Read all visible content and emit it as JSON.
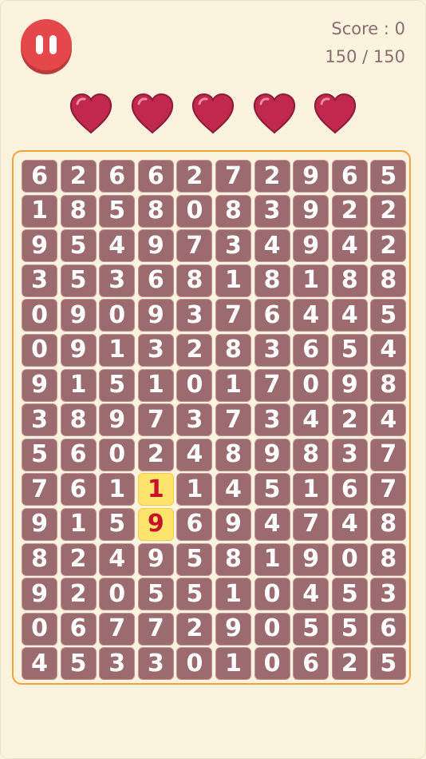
{
  "header": {
    "pause_icon": "pause-icon",
    "score_label": "Score : 0",
    "counter_label": "150 / 150"
  },
  "lives": {
    "count": 5,
    "icon": "heart-icon",
    "color": "#c0284d"
  },
  "colors": {
    "background": "#fbf3dd",
    "pause_button": "#e4484a",
    "cell": "#9c6b6f",
    "cell_highlight": "#fde46a",
    "highlight_text": "#c8102e",
    "board_border": "#f2a43a"
  },
  "board": {
    "rows": [
      [
        "6",
        "2",
        "6",
        "6",
        "2",
        "7",
        "2",
        "9",
        "6",
        "5"
      ],
      [
        "1",
        "8",
        "5",
        "8",
        "0",
        "8",
        "3",
        "9",
        "2",
        "2"
      ],
      [
        "9",
        "5",
        "4",
        "9",
        "7",
        "3",
        "4",
        "9",
        "4",
        "2"
      ],
      [
        "3",
        "5",
        "3",
        "6",
        "8",
        "1",
        "8",
        "1",
        "8",
        "8"
      ],
      [
        "0",
        "9",
        "0",
        "9",
        "3",
        "7",
        "6",
        "4",
        "4",
        "5"
      ],
      [
        "0",
        "9",
        "1",
        "3",
        "2",
        "8",
        "3",
        "6",
        "5",
        "4"
      ],
      [
        "9",
        "1",
        "5",
        "1",
        "0",
        "1",
        "7",
        "0",
        "9",
        "8"
      ],
      [
        "3",
        "8",
        "9",
        "7",
        "3",
        "7",
        "3",
        "4",
        "2",
        "4"
      ],
      [
        "5",
        "6",
        "0",
        "2",
        "4",
        "8",
        "9",
        "8",
        "3",
        "7"
      ],
      [
        "7",
        "6",
        "1",
        "1",
        "1",
        "4",
        "5",
        "1",
        "6",
        "7"
      ],
      [
        "9",
        "1",
        "5",
        "9",
        "6",
        "9",
        "4",
        "7",
        "4",
        "8"
      ],
      [
        "8",
        "2",
        "4",
        "9",
        "5",
        "8",
        "1",
        "9",
        "0",
        "8"
      ],
      [
        "9",
        "2",
        "0",
        "5",
        "5",
        "1",
        "0",
        "4",
        "5",
        "3"
      ],
      [
        "0",
        "6",
        "7",
        "7",
        "2",
        "9",
        "0",
        "5",
        "5",
        "6"
      ],
      [
        "4",
        "5",
        "3",
        "3",
        "0",
        "1",
        "0",
        "6",
        "2",
        "5"
      ]
    ],
    "highlighted": [
      [
        9,
        3
      ],
      [
        10,
        3
      ]
    ]
  }
}
